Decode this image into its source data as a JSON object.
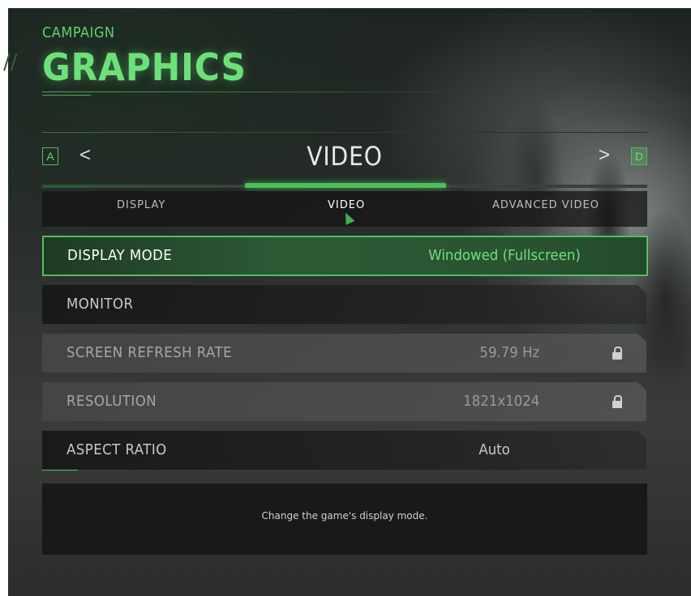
{
  "header": {
    "subtitle": "CAMPAIGN",
    "title": "GRAPHICS"
  },
  "nav": {
    "left_key": "A",
    "left_arrow": "<",
    "section_title": "VIDEO",
    "right_arrow": ">",
    "right_key": "D"
  },
  "tabs": [
    {
      "label": "DISPLAY",
      "active": false
    },
    {
      "label": "VIDEO",
      "active": true
    },
    {
      "label": "ADVANCED VIDEO",
      "active": false
    }
  ],
  "settings": [
    {
      "label": "DISPLAY MODE",
      "value": "Windowed (Fullscreen)",
      "selected": true,
      "locked": false
    },
    {
      "label": "MONITOR",
      "value": "",
      "selected": false,
      "locked": false
    },
    {
      "label": "SCREEN REFRESH RATE",
      "value": "59.79 Hz",
      "selected": false,
      "locked": true
    },
    {
      "label": "RESOLUTION",
      "value": "1821x1024",
      "selected": false,
      "locked": true
    },
    {
      "label": "ASPECT RATIO",
      "value": "Auto",
      "selected": false,
      "locked": false
    }
  ],
  "description": "Change the game's display mode.",
  "colors": {
    "accent_green": "#52c15f",
    "title_green": "#6ee07a"
  },
  "icons": {
    "lock": "lock-icon",
    "cursor": "mouse-cursor-icon"
  }
}
